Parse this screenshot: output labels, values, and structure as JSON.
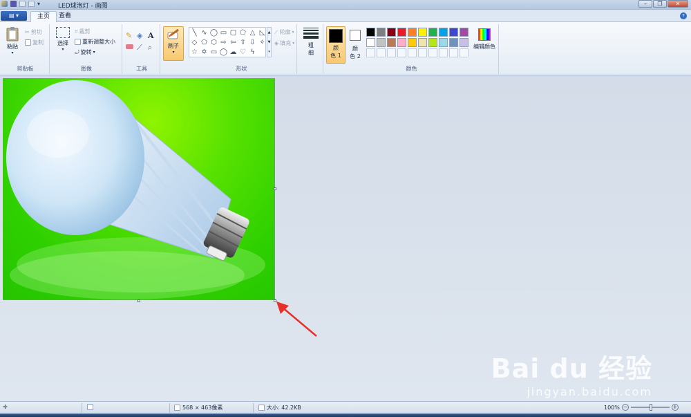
{
  "window": {
    "title": "LED球泡灯 - 画图"
  },
  "tabs": {
    "file": "▤ ▾",
    "home": "主页",
    "view": "查看"
  },
  "help": "?",
  "clipboard": {
    "paste": "粘贴",
    "cut": "剪切",
    "copy": "复制",
    "group": "剪贴板"
  },
  "image": {
    "select": "选择",
    "crop": "裁剪",
    "resize": "重新调整大小",
    "rotate": "旋转",
    "group": "图像"
  },
  "tools": {
    "group": "工具",
    "text_glyph": "A"
  },
  "brush": {
    "label": "刷子"
  },
  "shapes": {
    "outline": "轮廓",
    "fill": "填充",
    "group": "形状"
  },
  "size": {
    "label1": "粗",
    "label2": "细"
  },
  "colors": {
    "color1_a": "颜",
    "color1_b": "色 1",
    "color2_a": "颜",
    "color2_b": "色 2",
    "edit": "编辑颜色",
    "group": "颜色",
    "color1_value": "#000000",
    "color2_value": "#ffffff",
    "palette_row1": [
      "#000000",
      "#7f7f7f",
      "#880015",
      "#ed1c24",
      "#ff7f27",
      "#fff200",
      "#22b14c",
      "#00a2e8",
      "#3f48cc",
      "#a349a4"
    ],
    "palette_row2": [
      "#ffffff",
      "#c3c3c3",
      "#b97a57",
      "#ffaec9",
      "#ffc90e",
      "#efe4b0",
      "#b5e61d",
      "#99d9ea",
      "#7092be",
      "#c8bfe7"
    ]
  },
  "status": {
    "dimensions": "568 × 463像素",
    "filesize": "大小: 42.2KB",
    "zoom": "100%"
  },
  "watermark": {
    "brand": "Bai du 经验",
    "url": "jingyan.baidu.com"
  }
}
